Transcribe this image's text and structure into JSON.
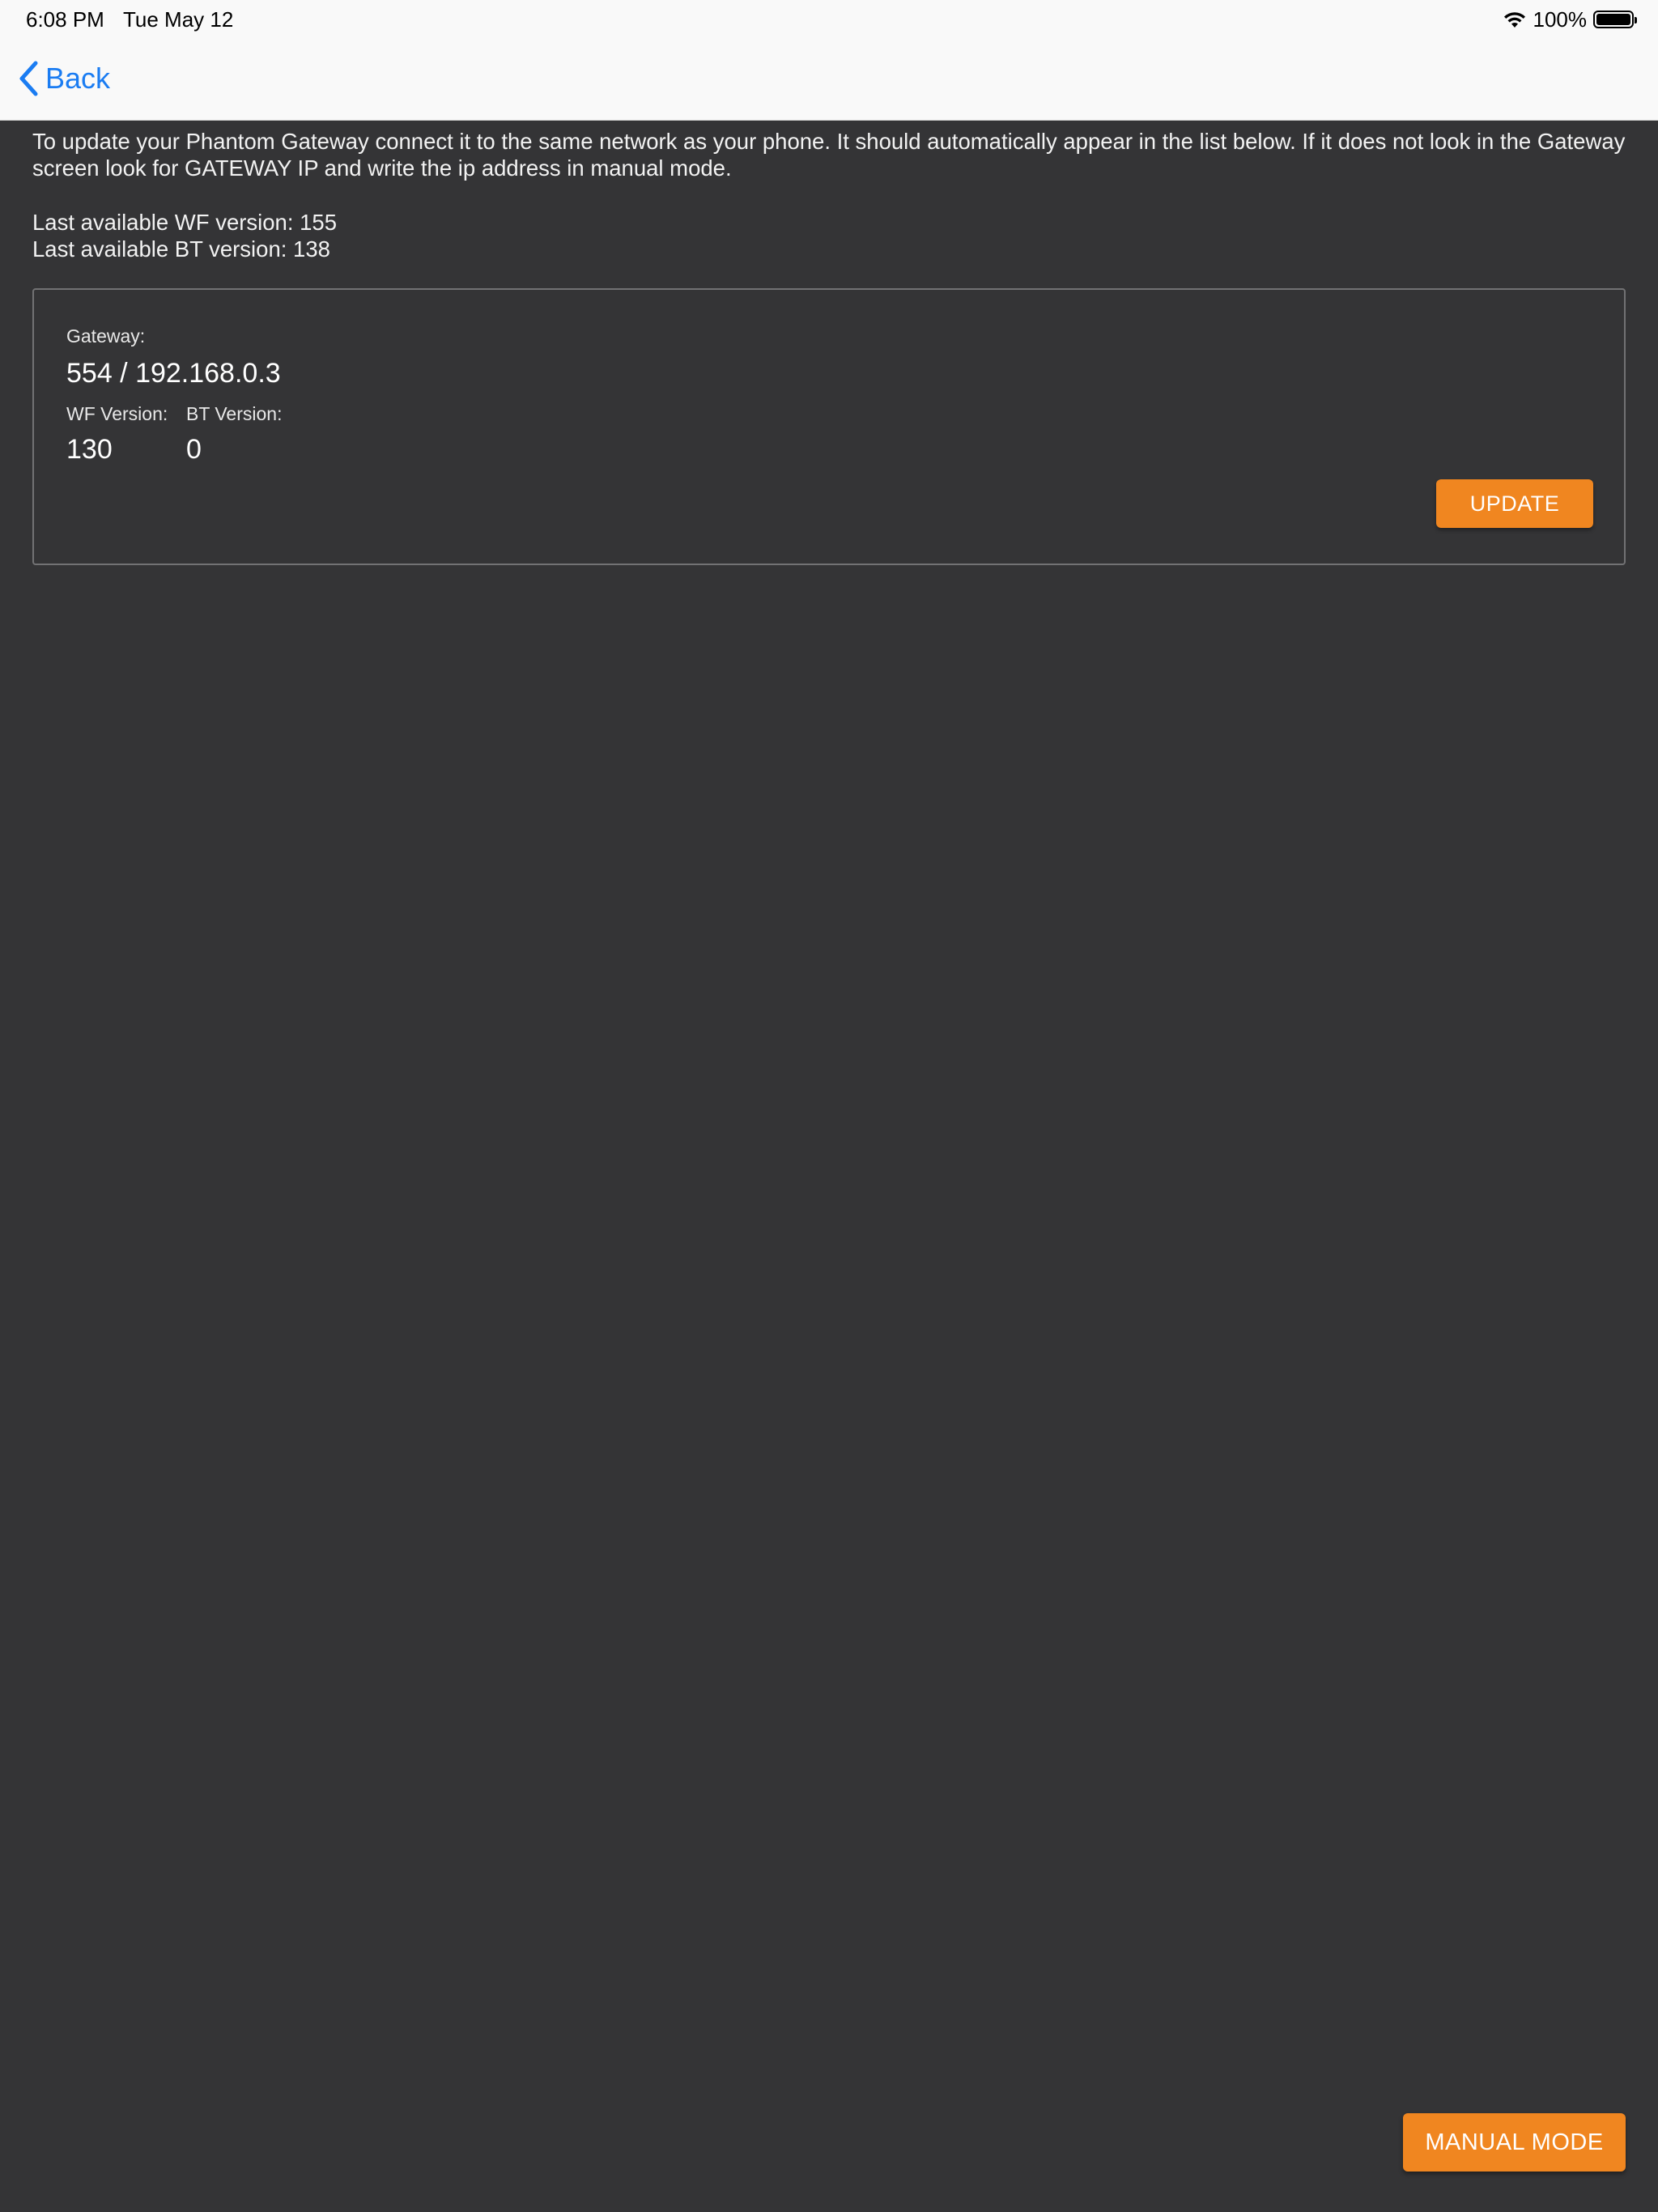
{
  "status_bar": {
    "time": "6:08 PM",
    "date": "Tue May 12",
    "battery_percent_label": "100%",
    "battery_level": 1.0,
    "icons": [
      "wifi-icon",
      "battery-icon"
    ]
  },
  "nav": {
    "back_label": "Back",
    "back_icon": "chevron-left-icon",
    "accent_color": "#1a7cf2"
  },
  "intro": {
    "text": "To update your Phantom Gateway connect it to the same network as your phone. It should automatically appear in the list below. If it does not look in the Gateway screen look for GATEWAY IP and write the ip address in manual mode.",
    "wf_version_line": "Last available WF version: 155",
    "bt_version_line": "Last available BT version: 138"
  },
  "gateway_card": {
    "gateway_label": "Gateway:",
    "gateway_value": "554 / 192.168.0.3",
    "wf_label": "WF Version:",
    "wf_value": "130",
    "bt_label": "BT Version:",
    "bt_value": "0",
    "update_label": "UPDATE"
  },
  "footer": {
    "manual_mode_label": "MANUAL MODE"
  },
  "colors": {
    "background": "#343436",
    "button_orange": "#f08620",
    "topbar": "#f9f9f9"
  }
}
